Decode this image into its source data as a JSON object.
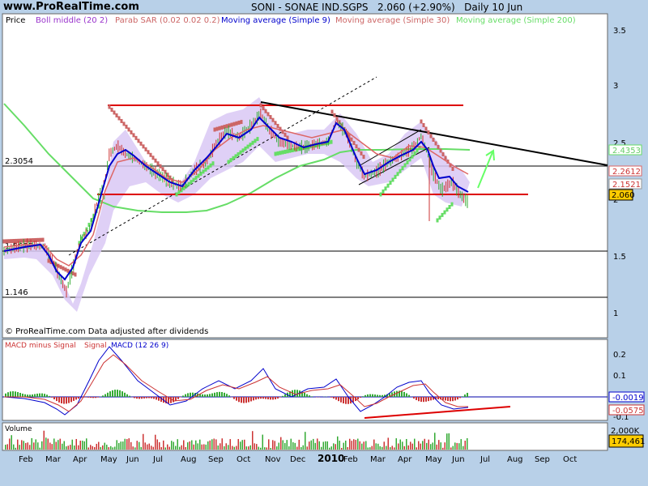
{
  "site": "www.ProRealTime.com",
  "header": {
    "symbol": "SONI - SONAE IND.SGPS",
    "price": "2.060 (+2.90%)",
    "period": "Daily 10 Jun"
  },
  "legend": [
    {
      "label": "Price",
      "color": "#000000"
    },
    {
      "label": "Boll middle (20 2)",
      "color": "#9933cc"
    },
    {
      "label": "Parab SAR (0.02 0.02 0.2)",
      "color": "#cc6666"
    },
    {
      "label": "Moving average (Simple 9)",
      "color": "#0000cc"
    },
    {
      "label": "Moving average (Simple 30)",
      "color": "#cc6666"
    },
    {
      "label": "Moving average (Simple 200)",
      "color": "#66dd66"
    }
  ],
  "copyright": "© ProRealTime.com Data adjusted after dividends",
  "macd_legend": {
    "a": "MACD minus Signal",
    "b": "Signal",
    "c": "MACD (12 26 9)"
  },
  "volume_label": "Volume",
  "colors": {
    "accent": "#cc0000",
    "green": "#66dd66",
    "blue": "#0000cc",
    "pink": "#cc6666",
    "band": "#d9c8f5"
  },
  "chart_data": [
    {
      "type": "line",
      "panel": "price",
      "x": [
        "Feb",
        "Mar",
        "Apr",
        "May",
        "Jun",
        "Jul",
        "Aug",
        "Sep",
        "Oct",
        "Nov",
        "Dec",
        "2010",
        "Feb",
        "Mar",
        "Apr",
        "May",
        "Jun",
        "Jul",
        "Aug",
        "Sep",
        "Oct"
      ],
      "series": [
        {
          "name": "Price",
          "values": [
            1.62,
            1.28,
            1.7,
            2.3,
            2.28,
            2.08,
            2.2,
            2.55,
            2.75,
            2.58,
            2.6,
            2.62,
            2.3,
            2.3,
            2.55,
            2.15,
            2.06
          ]
        },
        {
          "name": "Moving average (Simple 200)",
          "values": [
            2.75,
            2.3,
            2.05,
            2.0,
            1.98,
            1.95,
            1.98,
            2.08,
            2.18,
            2.28,
            2.4,
            2.45,
            2.45,
            2.44,
            2.44,
            2.44,
            2.435
          ]
        }
      ],
      "hlines": [
        2.3054,
        1.5685,
        1.146
      ],
      "hline_labels": [
        "2.3054",
        "1.5685",
        "1.146"
      ],
      "yticks": [
        "3.5",
        "3",
        "2.5",
        "2",
        "1.5",
        "1"
      ],
      "ylim": [
        0.85,
        3.6
      ],
      "right_labels": [
        "2.4353",
        "2.2612",
        "2.1521",
        "2.060"
      ]
    },
    {
      "type": "bar",
      "panel": "macd",
      "yticks": [
        "0.2",
        "0.1",
        "0",
        "-0.1"
      ],
      "ylim": [
        -0.11,
        0.28
      ],
      "right_labels": [
        "-0.0019",
        "-0.0575"
      ]
    },
    {
      "type": "bar",
      "panel": "volume",
      "right_labels": [
        "2,000K",
        "174,461"
      ]
    }
  ]
}
